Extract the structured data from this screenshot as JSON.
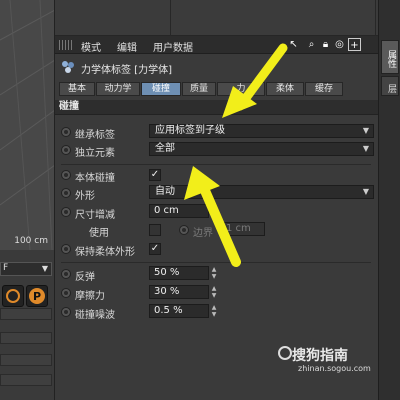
{
  "viewport": {
    "scale_label": "100 cm"
  },
  "left_panel": {
    "dropdown_value": "F"
  },
  "right_tabs": [
    {
      "label": "属性"
    },
    {
      "label": "层"
    }
  ],
  "menubar": {
    "items": [
      "模式",
      "编辑",
      "用户数据"
    ],
    "tools": [
      "arrow-up-left-icon",
      "search-icon",
      "lock-icon",
      "target-icon",
      "plus-box-icon"
    ]
  },
  "object": {
    "title": "力学体标签 [力学体]"
  },
  "tabs": [
    {
      "label": "基本",
      "active": false
    },
    {
      "label": "动力学",
      "active": false
    },
    {
      "label": "碰撞",
      "active": true
    },
    {
      "label": "质量",
      "active": false
    },
    {
      "label": "力",
      "active": false
    },
    {
      "label": "柔体",
      "active": false
    },
    {
      "label": "缓存",
      "active": false
    }
  ],
  "section_title": "碰撞",
  "rows": {
    "inherit_tag": {
      "label": "继承标签",
      "value": "应用标签到子级"
    },
    "independent": {
      "label": "独立元素",
      "value": "全部"
    },
    "self_collision": {
      "label": "本体碰撞",
      "checked": "✓"
    },
    "shape": {
      "label": "外形",
      "value": "自动"
    },
    "size_increment": {
      "label": "尺寸增减",
      "value": "0 cm"
    },
    "use": {
      "label": "使用",
      "border_label": "边界",
      "border_value": "1 cm"
    },
    "keep_soft_shape": {
      "label": "保持柔体外形",
      "checked": "✓"
    },
    "bounce": {
      "label": "反弹",
      "value": "50 %"
    },
    "friction": {
      "label": "摩擦力",
      "value": "30 %"
    },
    "collision_noise": {
      "label": "碰撞噪波",
      "value": "0.5 %"
    }
  },
  "watermark": {
    "text": "搜狗指南",
    "url": "zhinan.sogou.com"
  },
  "colors": {
    "arrow": "#f2ee1a",
    "tab_active": "#6e8fb3",
    "panel_bg": "#3a3a3a"
  }
}
